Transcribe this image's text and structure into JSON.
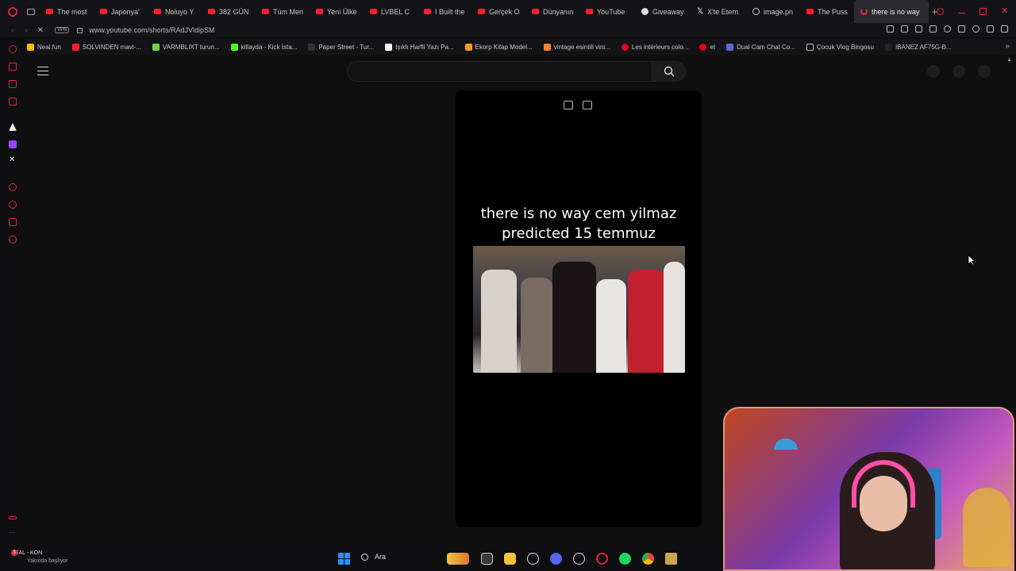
{
  "tabs": [
    {
      "label": "The most",
      "icon": "youtube-icon"
    },
    {
      "label": "Japonya'",
      "icon": "youtube-icon"
    },
    {
      "label": "Noluyo Y",
      "icon": "youtube-icon"
    },
    {
      "label": "382 GÜN",
      "icon": "youtube-icon"
    },
    {
      "label": "Tüm Men",
      "icon": "youtube-icon"
    },
    {
      "label": "Yeni Ülke",
      "icon": "youtube-icon"
    },
    {
      "label": "LVBEL C",
      "icon": "youtube-icon"
    },
    {
      "label": "I Built the",
      "icon": "youtube-icon"
    },
    {
      "label": "Gerçek O",
      "icon": "youtube-icon"
    },
    {
      "label": "Dünyanın",
      "icon": "youtube-icon"
    },
    {
      "label": "YouTube",
      "icon": "youtube-icon"
    },
    {
      "label": "Giveaway",
      "icon": "gift-icon"
    },
    {
      "label": "X'te Etern",
      "icon": "x-icon"
    },
    {
      "label": "image.pn",
      "icon": "globe-icon"
    },
    {
      "label": "The Puss",
      "icon": "youtube-icon"
    }
  ],
  "active_tab": {
    "label": "there is no way",
    "icon": "loading-spinner-icon"
  },
  "new_tab_label": "+",
  "address": {
    "vpn_label": "VPN",
    "url": "www.youtube.com/shorts/RAdJVldipSM"
  },
  "bookmarks": [
    {
      "label": "Neal.fun",
      "color": "#f2c200"
    },
    {
      "label": "SOLVINDEN mavi-...",
      "color": "#ff1e2e"
    },
    {
      "label": "VARMBLIXT turun...",
      "color": "#6dd14d"
    },
    {
      "label": "killayda - Kick İsta...",
      "color": "#53fc18"
    },
    {
      "label": "Paper Street - Tur...",
      "color": "#333333"
    },
    {
      "label": "Işıklı Harfli Yazı Pa...",
      "color": "#ffffff"
    },
    {
      "label": "Ekorp Kitap Model...",
      "color": "#f29b2c"
    },
    {
      "label": "vintage esintili vini...",
      "color": "#f6822e"
    },
    {
      "label": "Les intérieurs colo...",
      "color": "#e60023"
    },
    {
      "label": "et",
      "color": "#e60023"
    },
    {
      "label": "Dual Cam Chat Co...",
      "color": "#5b6bd8"
    },
    {
      "label": "Çocuk Vlog Bingosu",
      "color": "#bbbbbb"
    },
    {
      "label": "IBANEZ AF75G-B...",
      "color": "#222222"
    }
  ],
  "short": {
    "caption": "there is no way cem yilmaz predicted 15 temmuz"
  },
  "taskbar": {
    "match_badge": "3",
    "match_title": "GAL - KON",
    "match_subtitle": "Yakında başlıyor",
    "search_label": "Ara"
  },
  "colors": {
    "accent": "#e0243a",
    "background": "#0f0f0f",
    "youtube_red": "#ff1e2e"
  }
}
